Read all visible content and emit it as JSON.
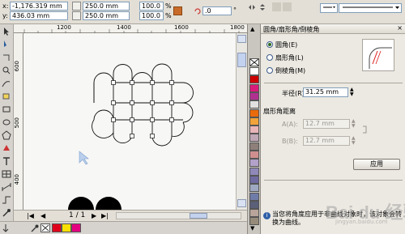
{
  "propbar": {
    "x_label": "x:",
    "y_label": "y:",
    "x_value": "-1,176.319 mm",
    "y_value": "436.03 mm",
    "w_value": "250.0 mm",
    "h_value": "250.0 mm",
    "scale_x": "100.0",
    "scale_y": "100.0",
    "scale_unit": "%",
    "angle_value": ".0",
    "angle_unit": "°"
  },
  "hruler": {
    "ticks": [
      "1200",
      "1400",
      "1600",
      "1800"
    ]
  },
  "vruler": {
    "ticks": [
      "600",
      "500",
      "400"
    ]
  },
  "pagebar": {
    "page_counter": "1 / 1"
  },
  "palette": {
    "colors": [
      "#ffffff",
      "#cc0000",
      "#d81b7a",
      "#b03090",
      "#e0e0e0",
      "#e96b0c",
      "#f2a33a",
      "#e8b4b8",
      "#c0a7b5",
      "#8e7f7a",
      "#d08f8f",
      "#b2a1c9",
      "#8f88b8",
      "#6f6aa0",
      "#9ea8c0",
      "#707ca8",
      "#5b5f78",
      "#b8a49a",
      "#968a7a"
    ]
  },
  "swatches": [
    "#e0001b",
    "#f9e000",
    "#e4007f"
  ],
  "docker": {
    "title": "圆角/扇形角/倒棱角",
    "options": [
      {
        "label": "圆角(E)",
        "selected": true
      },
      {
        "label": "扇形角(L)",
        "selected": false
      },
      {
        "label": "倒棱角(M)",
        "selected": false
      }
    ],
    "radius_label": "半径(R):",
    "radius_value": "31.25 mm",
    "distance_title": "扇形角距离",
    "a_label": "A(A):",
    "a_value": "12.7 mm",
    "b_label": "B(B):",
    "b_value": "12.7 mm",
    "apply_button": "应用",
    "info_text": "当您将角度应用于非曲线对象时，该对象会转换为曲线。"
  },
  "watermark": {
    "text": "Bai du 经验",
    "sub": "jingyan.baidu.com"
  }
}
